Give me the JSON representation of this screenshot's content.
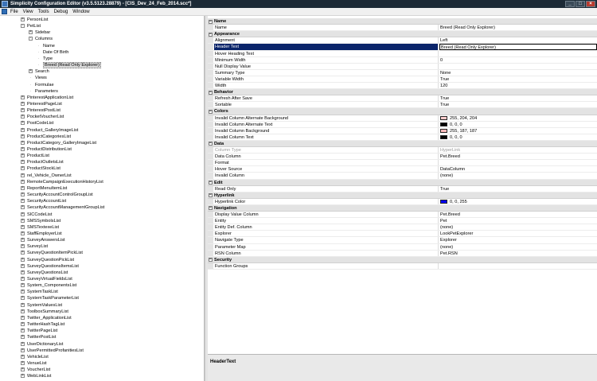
{
  "window": {
    "title": "Simplicity Configuration Editor (v3.5.5123.28879) - [CIS_Dev_24_Feb_2014.scc*]"
  },
  "menu": [
    "File",
    "View",
    "Tools",
    "Debug",
    "Window"
  ],
  "tree": [
    {
      "label": "PersonList",
      "level": 2,
      "exp": "+"
    },
    {
      "label": "PetList",
      "level": 2,
      "exp": "-"
    },
    {
      "label": "Sidebar",
      "level": 3,
      "exp": "+"
    },
    {
      "label": "Columns",
      "level": 3,
      "exp": "-"
    },
    {
      "label": "Name",
      "level": 4,
      "exp": ""
    },
    {
      "label": "Date Of Birth",
      "level": 4,
      "exp": ""
    },
    {
      "label": "Type",
      "level": 4,
      "exp": ""
    },
    {
      "label": "Breed (Read Only Explorer)",
      "level": 4,
      "exp": "",
      "selected": true
    },
    {
      "label": "Search",
      "level": 3,
      "exp": "+"
    },
    {
      "label": "Views",
      "level": 3,
      "exp": ""
    },
    {
      "label": "Formulae",
      "level": 3,
      "exp": ""
    },
    {
      "label": "Parameters",
      "level": 3,
      "exp": ""
    },
    {
      "label": "PinterestApplicationList",
      "level": 2,
      "exp": "+"
    },
    {
      "label": "PinterestPageList",
      "level": 2,
      "exp": "+"
    },
    {
      "label": "PinterestPostList",
      "level": 2,
      "exp": "+"
    },
    {
      "label": "PocketVoucherList",
      "level": 2,
      "exp": "+"
    },
    {
      "label": "PostCodeList",
      "level": 2,
      "exp": "+"
    },
    {
      "label": "Product_GalleryImageList",
      "level": 2,
      "exp": "+"
    },
    {
      "label": "ProductCategoriesList",
      "level": 2,
      "exp": "+"
    },
    {
      "label": "ProductCategory_GalleryImageList",
      "level": 2,
      "exp": "+"
    },
    {
      "label": "ProductDistributionList",
      "level": 2,
      "exp": "+"
    },
    {
      "label": "ProductList",
      "level": 2,
      "exp": "+"
    },
    {
      "label": "ProductOutletsList",
      "level": 2,
      "exp": "+"
    },
    {
      "label": "ProductStockList",
      "level": 2,
      "exp": "+"
    },
    {
      "label": "rel_Vehicle_OwnerList",
      "level": 2,
      "exp": "+"
    },
    {
      "label": "RemoteCampaignExecutionHistoryList",
      "level": 2,
      "exp": "+"
    },
    {
      "label": "ReportMenuItemList",
      "level": 2,
      "exp": "+"
    },
    {
      "label": "SecurityAccountControlGroupList",
      "level": 2,
      "exp": "+"
    },
    {
      "label": "SecurityAccountList",
      "level": 2,
      "exp": "+"
    },
    {
      "label": "SecurityAccountManagementGroupList",
      "level": 2,
      "exp": "+"
    },
    {
      "label": "SICCodeList",
      "level": 2,
      "exp": "+"
    },
    {
      "label": "SMSSymbolsList",
      "level": 2,
      "exp": "+"
    },
    {
      "label": "SMSTextexeList",
      "level": 2,
      "exp": "+"
    },
    {
      "label": "StaffEmployerList",
      "level": 2,
      "exp": "+"
    },
    {
      "label": "SurveyAnswersList",
      "level": 2,
      "exp": "+"
    },
    {
      "label": "SurveyList",
      "level": 2,
      "exp": "+"
    },
    {
      "label": "SurveyQuestionItemPickList",
      "level": 2,
      "exp": "+"
    },
    {
      "label": "SurveyQuestionPickList",
      "level": 2,
      "exp": "+"
    },
    {
      "label": "SurveyQuestionsItemsList",
      "level": 2,
      "exp": "+"
    },
    {
      "label": "SurveyQuestionsList",
      "level": 2,
      "exp": "+"
    },
    {
      "label": "SurveyVirtualFieldsList",
      "level": 2,
      "exp": "+"
    },
    {
      "label": "System_ComponentsList",
      "level": 2,
      "exp": "+"
    },
    {
      "label": "SystemTaskList",
      "level": 2,
      "exp": "+"
    },
    {
      "label": "SystemTaskParameterList",
      "level": 2,
      "exp": "+"
    },
    {
      "label": "SystemValuesList",
      "level": 2,
      "exp": "+"
    },
    {
      "label": "ToolboxSummaryList",
      "level": 2,
      "exp": "+"
    },
    {
      "label": "Twitter_ApplicationList",
      "level": 2,
      "exp": "+"
    },
    {
      "label": "TwitterHashTagList",
      "level": 2,
      "exp": "+"
    },
    {
      "label": "TwitterPageList",
      "level": 2,
      "exp": "+"
    },
    {
      "label": "TwitterPostList",
      "level": 2,
      "exp": "+"
    },
    {
      "label": "UserDictionaryList",
      "level": 2,
      "exp": "+"
    },
    {
      "label": "UserPermittedProfanitiesList",
      "level": 2,
      "exp": "+"
    },
    {
      "label": "VehicleList",
      "level": 2,
      "exp": "+"
    },
    {
      "label": "VenueList",
      "level": 2,
      "exp": "+"
    },
    {
      "label": "VoucherList",
      "level": 2,
      "exp": "+"
    },
    {
      "label": "WebLinkList",
      "level": 2,
      "exp": "+"
    }
  ],
  "properties": [
    {
      "type": "cat",
      "label": "Name"
    },
    {
      "type": "prop",
      "name": "Name",
      "value": "Breed (Read Only Explorer)"
    },
    {
      "type": "cat",
      "label": "Appearance"
    },
    {
      "type": "prop",
      "name": "Alignment",
      "value": "Left"
    },
    {
      "type": "prop",
      "name": "Header Text",
      "value": "Breed (Read Only Explorer)",
      "selected": true
    },
    {
      "type": "prop",
      "name": "Hover Heading Text",
      "value": ""
    },
    {
      "type": "prop",
      "name": "Minimum Width",
      "value": "0"
    },
    {
      "type": "prop",
      "name": "Null Display Value",
      "value": ""
    },
    {
      "type": "prop",
      "name": "Summary Type",
      "value": "None"
    },
    {
      "type": "prop",
      "name": "Variable Width",
      "value": "True"
    },
    {
      "type": "prop",
      "name": "Width",
      "value": "120"
    },
    {
      "type": "cat",
      "label": "Behavior"
    },
    {
      "type": "prop",
      "name": "Refresh After Save",
      "value": "True"
    },
    {
      "type": "prop",
      "name": "Sortable",
      "value": "True"
    },
    {
      "type": "cat",
      "label": "Colors"
    },
    {
      "type": "prop",
      "name": "Invalid Column Alternate Background",
      "value": "255, 204, 204",
      "swatch": "#ffcccc"
    },
    {
      "type": "prop",
      "name": "Invalid Column Alternate Text",
      "value": "0, 0, 0",
      "swatch": "#000000"
    },
    {
      "type": "prop",
      "name": "Invalid Column Background",
      "value": "255, 187, 187",
      "swatch": "#ffbbbb"
    },
    {
      "type": "prop",
      "name": "Invalid Column Text",
      "value": "0, 0, 0",
      "swatch": "#000000"
    },
    {
      "type": "cat",
      "label": "Data"
    },
    {
      "type": "prop",
      "name": "Column Type",
      "value": "HyperLink",
      "disabled": true
    },
    {
      "type": "prop",
      "name": "Data Column",
      "value": "Pet.Breed"
    },
    {
      "type": "prop",
      "name": "Format",
      "value": ""
    },
    {
      "type": "prop",
      "name": "Hover Source",
      "value": "DataColumn"
    },
    {
      "type": "prop",
      "name": "Invalid Column",
      "value": "(none)"
    },
    {
      "type": "cat",
      "label": "Edit"
    },
    {
      "type": "prop",
      "name": "Read Only",
      "value": "True"
    },
    {
      "type": "cat",
      "label": "Hyperlink"
    },
    {
      "type": "prop",
      "name": "Hyperlink Color",
      "value": "0, 0, 255",
      "swatch": "#0000ff"
    },
    {
      "type": "cat",
      "label": "Navigation"
    },
    {
      "type": "prop",
      "name": "Display Value Column",
      "value": "Pet.Breed"
    },
    {
      "type": "prop",
      "name": "Entity",
      "value": "Pet"
    },
    {
      "type": "prop",
      "name": "Entity Def. Column",
      "value": "(none)"
    },
    {
      "type": "prop",
      "name": "Explorer",
      "value": "LookPetExplorer"
    },
    {
      "type": "prop",
      "name": "Navigate Type",
      "value": "Explorer"
    },
    {
      "type": "prop",
      "name": "Parameter Map",
      "value": "(none)"
    },
    {
      "type": "prop",
      "name": "RSN Column",
      "value": "Pet.RSN"
    },
    {
      "type": "cat",
      "label": "Security"
    },
    {
      "type": "prop",
      "name": "Function Groups",
      "value": ""
    }
  ],
  "help": {
    "title": "HeaderText"
  },
  "colors": {
    "titlebar": "#1c2a36",
    "selection": "#0a246a",
    "category": "#e3e3e3"
  }
}
